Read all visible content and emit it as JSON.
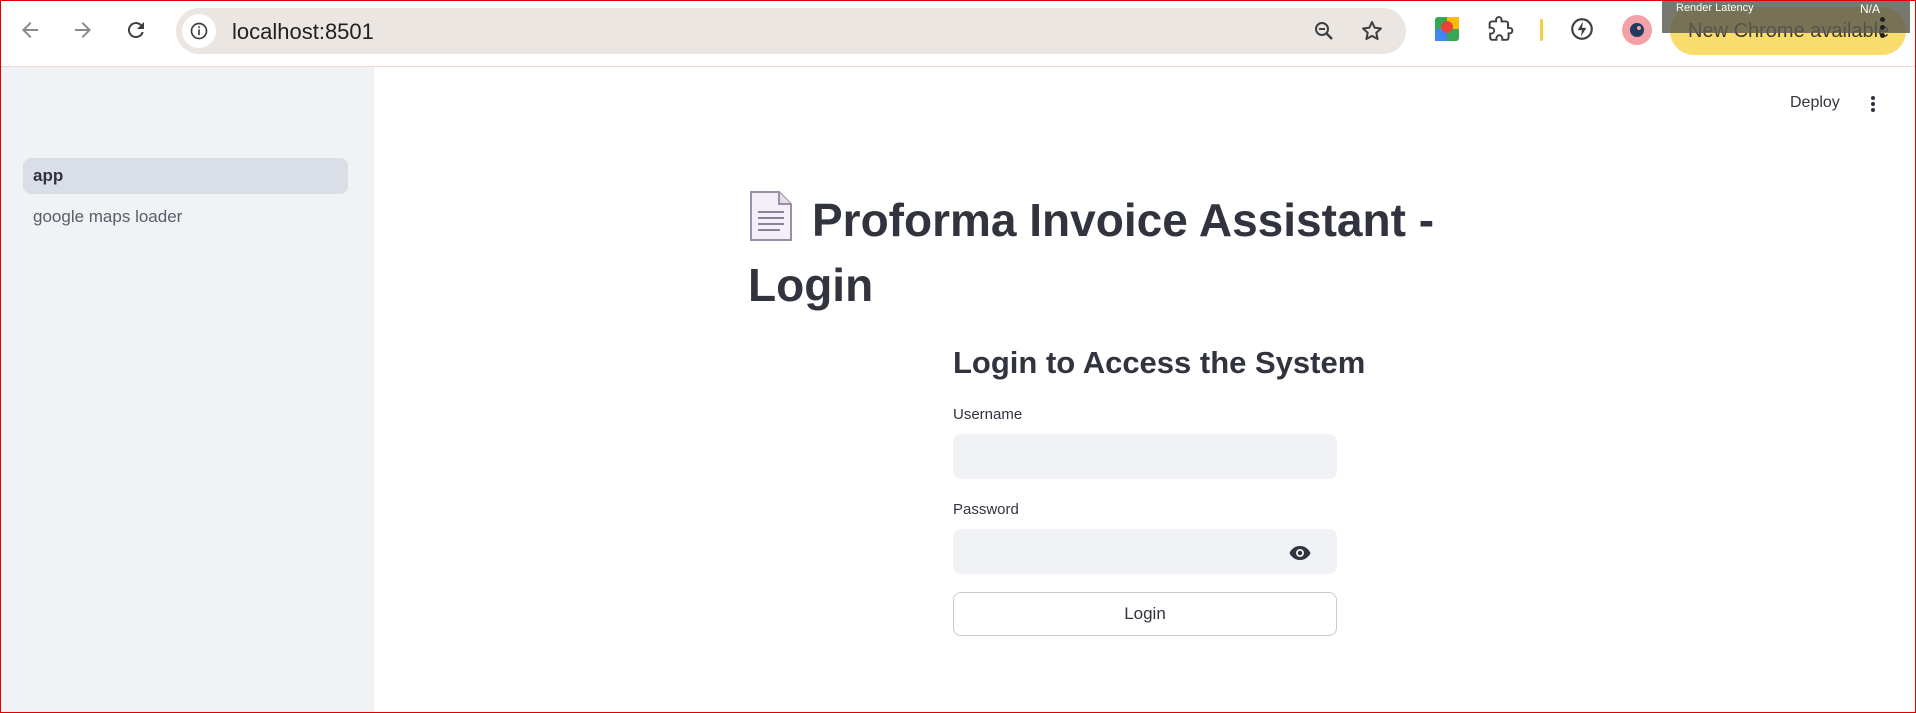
{
  "browser": {
    "url": "localhost:8501",
    "update_label": "New Chrome available",
    "render_latency_label": "Render Latency",
    "render_latency_value": "N/A"
  },
  "sidebar": {
    "items": [
      {
        "label": "app",
        "active": true
      },
      {
        "label": "google maps loader",
        "active": false
      }
    ]
  },
  "header": {
    "deploy_label": "Deploy"
  },
  "main": {
    "title": "Proforma Invoice Assistant - Login",
    "subtitle": "Login to Access the System",
    "username_label": "Username",
    "username_value": "",
    "password_label": "Password",
    "password_value": "",
    "login_label": "Login"
  },
  "colors": {
    "omnibox": "#ece6e3",
    "update_pill": "#f8dc6e",
    "sidebar_bg": "#f0f2f6",
    "active_item": "#dadee7",
    "text": "#31333f"
  }
}
